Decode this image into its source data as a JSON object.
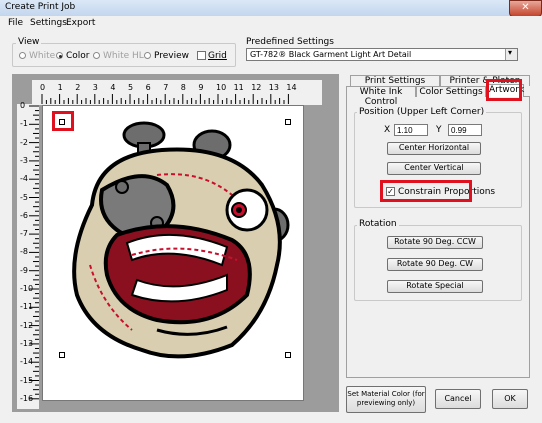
{
  "window": {
    "title": "Create Print Job",
    "close_glyph": "✕"
  },
  "menu": {
    "items": [
      "File",
      "Settings",
      "Export"
    ]
  },
  "view": {
    "label": "View",
    "options": [
      {
        "label": "White",
        "enabled": false,
        "selected": false
      },
      {
        "label": "Color",
        "enabled": true,
        "selected": true
      },
      {
        "label": "White HL",
        "enabled": false,
        "selected": false
      },
      {
        "label": "Preview",
        "enabled": true,
        "selected": false
      }
    ],
    "grid_label": "Grid",
    "grid_checked": false
  },
  "predefined": {
    "label": "Predefined Settings",
    "value": "GT-782® Black Garment Light Art Detail"
  },
  "rulers": {
    "top": [
      "0",
      "1",
      "2",
      "3",
      "4",
      "5",
      "6",
      "7",
      "8",
      "9",
      "10",
      "11",
      "12",
      "13",
      "14"
    ],
    "left": [
      "0",
      "-1",
      "-2",
      "-3",
      "-4",
      "-5",
      "-6",
      "-7",
      "-8",
      "-9",
      "-10",
      "-11",
      "-12",
      "-13",
      "-14",
      "-15",
      "-16"
    ]
  },
  "tabs": {
    "row1": [
      "Print Settings",
      "Printer & Platen"
    ],
    "row2": [
      "White Ink Control",
      "Color Settings",
      "Artwork"
    ],
    "active": "Artwork"
  },
  "position": {
    "label": "Position (Upper Left Corner)",
    "x_label": "X",
    "x_value": "1.10",
    "y_label": "Y",
    "y_value": "0.99",
    "center_h": "Center Horizontal",
    "center_v": "Center Vertical",
    "constrain_label": "Constrain Proportions",
    "constrain_checked": true
  },
  "rotation": {
    "label": "Rotation",
    "ccw": "Rotate 90 Deg. CCW",
    "cw": "Rotate 90 Deg. CW",
    "special": "Rotate Special"
  },
  "footer": {
    "material_color": "Set Material Color (for previewing only)",
    "cancel": "Cancel",
    "ok": "OK"
  },
  "colors": {
    "highlight": "#e0111f",
    "canvas_bg": "#9c9c9c"
  }
}
